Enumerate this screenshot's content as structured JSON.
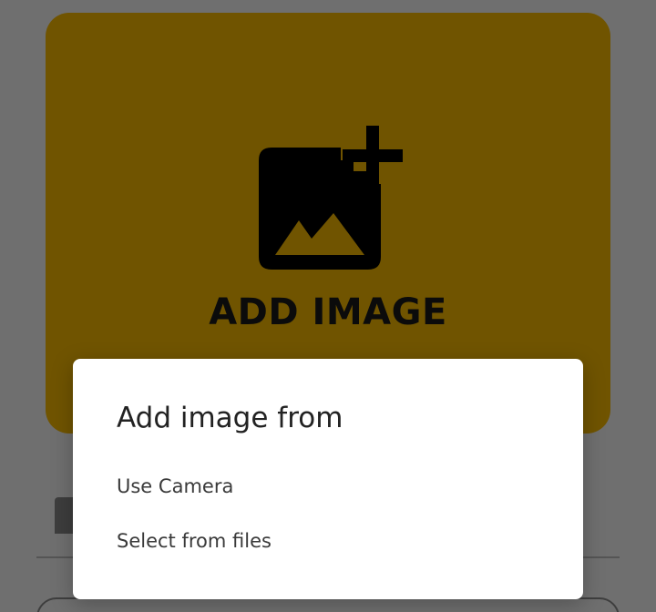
{
  "card": {
    "label": "ADD IMAGE",
    "icon": "add-photo-icon",
    "background_color": "#705400"
  },
  "dialog": {
    "title": "Add image from",
    "options": [
      {
        "label": "Use Camera",
        "icon": "camera"
      },
      {
        "label": "Select from files",
        "icon": "files"
      }
    ]
  },
  "colors": {
    "scrim": "#6f6f6f",
    "dialog_background": "#ffffff",
    "text_primary": "#222222"
  }
}
